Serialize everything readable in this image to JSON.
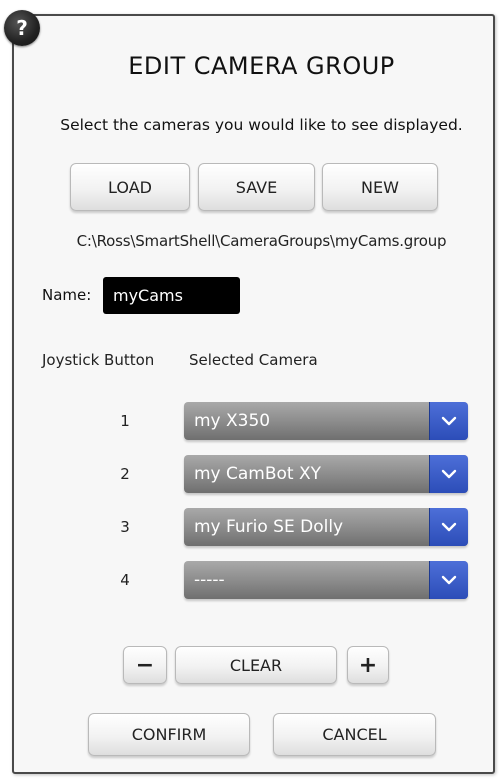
{
  "dialog": {
    "help_icon": "?",
    "title": "EDIT CAMERA GROUP",
    "subtitle": "Select the cameras you would like to see displayed."
  },
  "toolbar": {
    "load_label": "LOAD",
    "save_label": "SAVE",
    "new_label": "NEW"
  },
  "file_path": "C:\\Ross\\SmartShell\\CameraGroups\\myCams.group",
  "name": {
    "label": "Name:",
    "value": "myCams"
  },
  "columns": {
    "joystick": "Joystick Button",
    "camera": "Selected Camera"
  },
  "rows": [
    {
      "number": "1",
      "camera": "my X350"
    },
    {
      "number": "2",
      "camera": "my CamBot XY"
    },
    {
      "number": "3",
      "camera": "my Furio SE Dolly"
    },
    {
      "number": "4",
      "camera": "-----"
    }
  ],
  "controls": {
    "minus_label": "−",
    "clear_label": "CLEAR",
    "plus_label": "+"
  },
  "footer": {
    "confirm_label": "CONFIRM",
    "cancel_label": "CANCEL"
  },
  "colors": {
    "dropdown_arrow": "#3358c8",
    "name_field_bg": "#000000"
  },
  "icons": {
    "help": "help-icon",
    "dropdown": "chevron-down-icon"
  }
}
